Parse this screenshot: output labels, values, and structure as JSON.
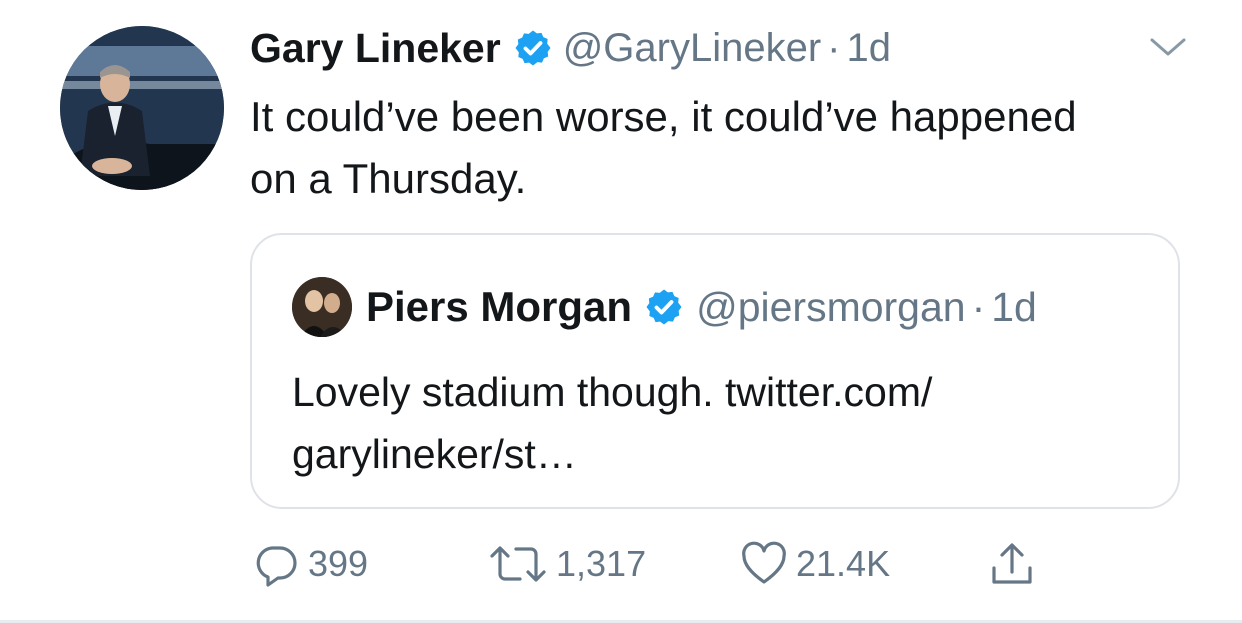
{
  "tweet": {
    "author_name": "Gary Lineker",
    "handle": "@GaryLineker",
    "separator": "·",
    "time": "1d",
    "text": "It could’ve been worse, it could’ve happened on a Thursday.",
    "verified": true
  },
  "quoted_tweet": {
    "author_name": "Piers Morgan",
    "handle": "@piersmorgan",
    "separator": "·",
    "time": "1d",
    "text": "Lovely stadium though. twitter.com/ garylineker/st…",
    "verified": true
  },
  "actions": {
    "reply_count": "399",
    "retweet_count": "1,317",
    "like_count": "21.4K"
  },
  "icons": {
    "verified": "verified-badge-icon",
    "menu": "chevron-down-icon",
    "reply": "reply-icon",
    "retweet": "retweet-icon",
    "like": "heart-icon",
    "share": "share-icon"
  },
  "colors": {
    "verified_blue": "#1da1f2",
    "secondary_text": "#657786",
    "primary_text": "#14171a",
    "border": "#dfe3e8"
  }
}
